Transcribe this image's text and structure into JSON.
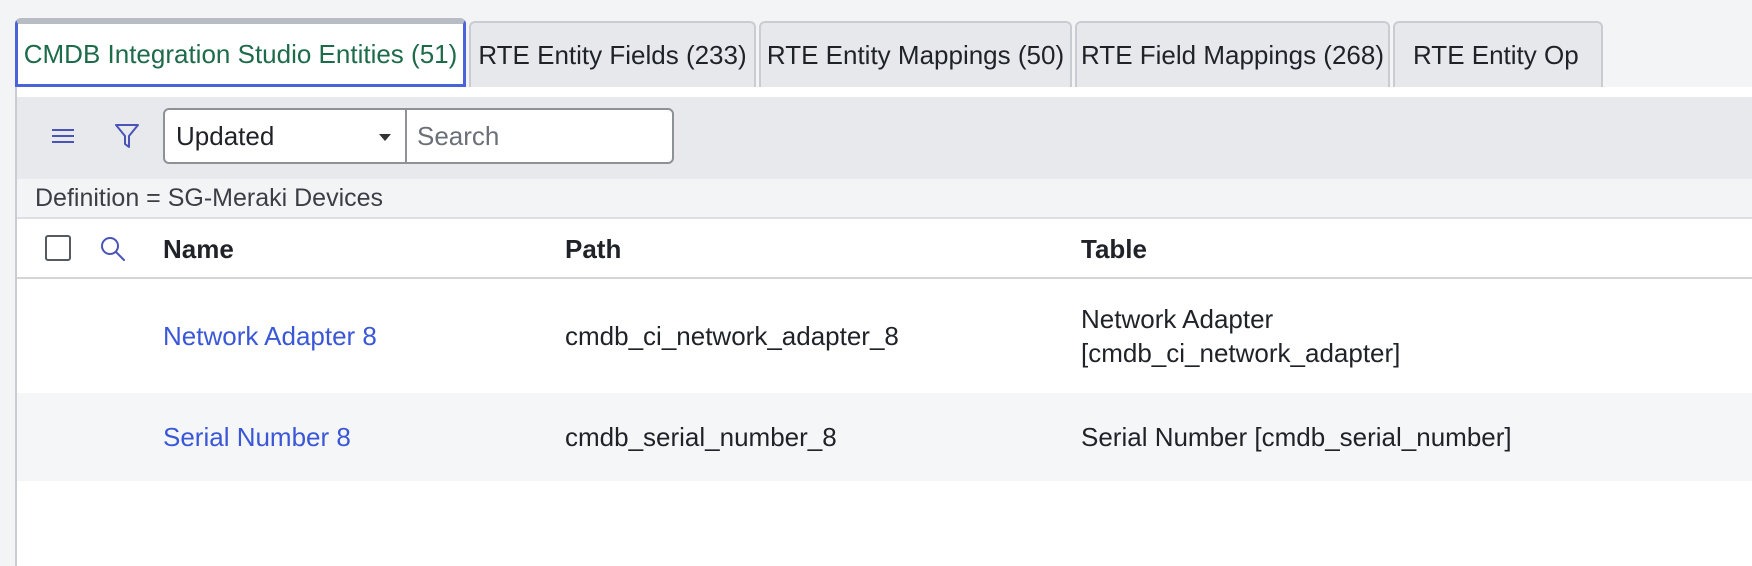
{
  "tabs": [
    {
      "label": "CMDB Integration Studio Entities (51)",
      "active": true
    },
    {
      "label": "RTE Entity Fields (233)",
      "active": false
    },
    {
      "label": "RTE Entity Mappings (50)",
      "active": false
    },
    {
      "label": "RTE Field Mappings (268)",
      "active": false
    },
    {
      "label": "RTE Entity Op",
      "active": false
    }
  ],
  "toolbar": {
    "sort_selected": "Updated",
    "search_placeholder": "Search"
  },
  "filter": {
    "text": "Definition = SG-Meraki Devices"
  },
  "table": {
    "columns": [
      "Name",
      "Path",
      "Table"
    ],
    "rows": [
      {
        "name": "Network Adapter 8",
        "path": "cmdb_ci_network_adapter_8",
        "table_line1": "Network Adapter",
        "table_line2": "[cmdb_ci_network_adapter]"
      },
      {
        "name": "Serial Number 8",
        "path": "cmdb_serial_number_8",
        "table_line1": "Serial Number [cmdb_serial_number]",
        "table_line2": ""
      }
    ]
  },
  "colors": {
    "link": "#3a57d8",
    "active_tab_text": "#1e6b4a",
    "active_tab_border": "#4a63d8"
  }
}
